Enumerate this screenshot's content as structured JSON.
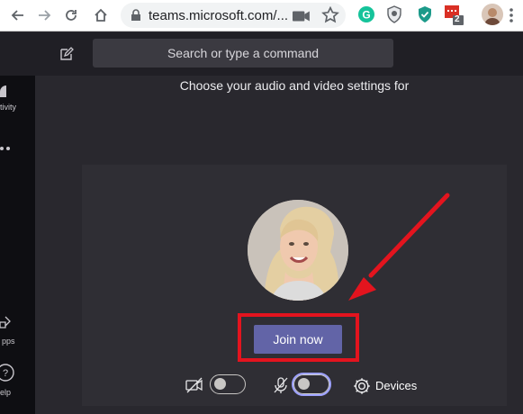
{
  "browser": {
    "url": "teams.microsoft.com/...",
    "extension_badge": "2",
    "icons": [
      "back-arrow-icon",
      "forward-arrow-icon",
      "reload-icon",
      "home-icon",
      "lock-icon",
      "camera-icon",
      "star-icon",
      "grammarly-icon",
      "shield-icon",
      "ghostery-icon",
      "extension-icon",
      "profile-avatar"
    ]
  },
  "teams": {
    "search_placeholder": "Search or type a command",
    "rail": {
      "activity_label": "tivity",
      "apps_label": "pps",
      "help_label": "elp"
    },
    "prejoin": {
      "title": "Choose your audio and video settings for",
      "join_label": "Join now",
      "devices_label": "Devices",
      "camera_on": false,
      "mic_on": false
    }
  },
  "annotation": {
    "highlight_color": "#e3141e",
    "arrow_color": "#e3141e"
  },
  "colors": {
    "accent": "#6264a7",
    "background": "#29282e"
  }
}
